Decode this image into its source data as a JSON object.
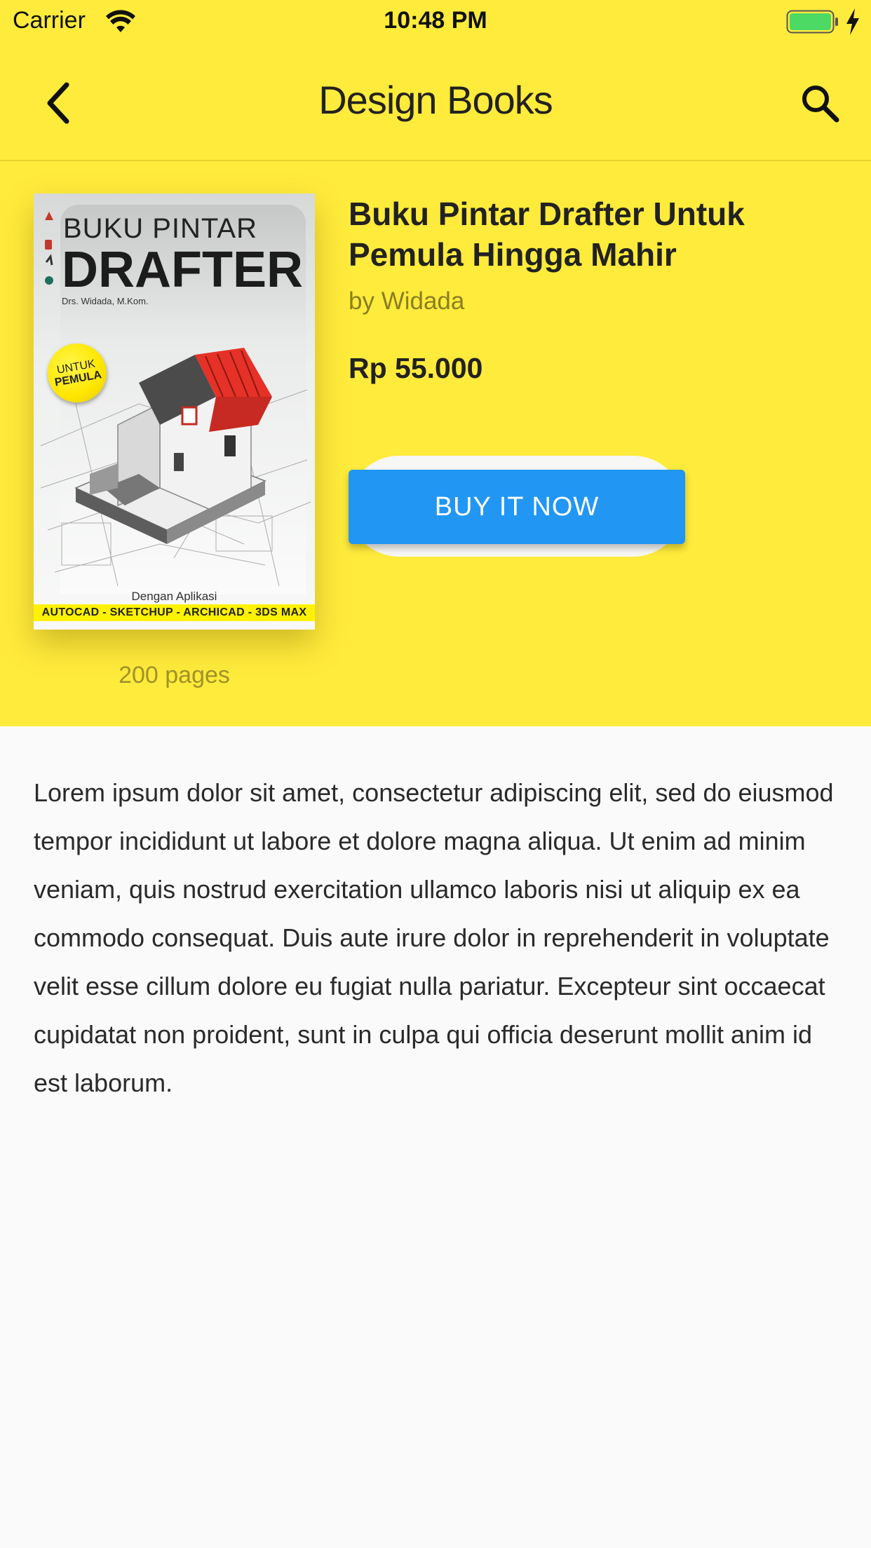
{
  "status_bar": {
    "carrier": "Carrier",
    "time": "10:48 PM",
    "icons": [
      "wifi-icon",
      "battery-icon",
      "charging-icon"
    ]
  },
  "app_bar": {
    "title": "Design Books",
    "back_icon": "chevron-left-icon",
    "search_icon": "search-icon"
  },
  "book": {
    "title": "Buku Pintar Drafter Untuk Pemula Hingga Mahir",
    "author": "by Widada",
    "price": "Rp 55.000",
    "buy_label": "BUY IT NOW",
    "pages": "200 pages",
    "cover": {
      "title_top": "BUKU PINTAR",
      "title_big": "DRAFTER",
      "author": "Drs. Widada, M.Kom.",
      "badge_line1": "UNTUK",
      "badge_line2": "PEMULA",
      "app_label": "Dengan Aplikasi",
      "strip": "AUTOCAD - SKETCHUP - ARCHICAD - 3DS MAX"
    }
  },
  "description": "Lorem ipsum dolor sit amet, consectetur adipiscing elit, sed do eiusmod tempor incididunt ut labore et dolore magna aliqua. Ut enim ad minim veniam, quis nostrud exercitation ullamco laboris nisi ut aliquip ex ea commodo consequat. Duis aute irure dolor in reprehenderit in voluptate velit esse cillum dolore eu fugiat nulla pariatur. Excepteur sint occaecat cupidatat non proident, sunt in culpa qui officia deserunt mollit anim id est laborum.",
  "colors": {
    "header_background": "#ffeb3b",
    "buy_button": "#2196f3",
    "body_background": "#fafafa"
  }
}
